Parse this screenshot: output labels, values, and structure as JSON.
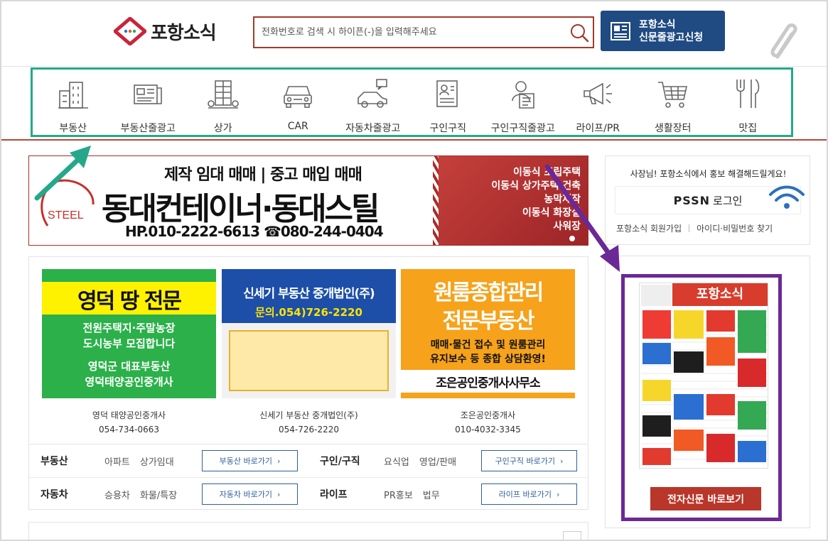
{
  "header": {
    "logo_text": "포항소식",
    "search_placeholder": "전화번호로 검색 시 하이픈(-)을 입력해주세요",
    "ad_button_line1": "포항소식",
    "ad_button_line2": "신문줄광고신청"
  },
  "nav": {
    "items": [
      {
        "label": "부동산",
        "icon": "building-icon"
      },
      {
        "label": "부동산줄광고",
        "icon": "newspaper-icon"
      },
      {
        "label": "상가",
        "icon": "store-icon"
      },
      {
        "label": "CAR",
        "icon": "car-icon"
      },
      {
        "label": "자동차줄광고",
        "icon": "car-message-icon"
      },
      {
        "label": "구인구직",
        "icon": "resume-icon"
      },
      {
        "label": "구인구직줄광고",
        "icon": "job-seeker-icon"
      },
      {
        "label": "라이프/PR",
        "icon": "megaphone-icon"
      },
      {
        "label": "생활장터",
        "icon": "cart-icon"
      },
      {
        "label": "맛집",
        "icon": "fork-knife-icon"
      }
    ]
  },
  "banner": {
    "logo_text": "STEEL",
    "top_line": "제작 임대 매매 | 중고 매입 매매",
    "main_line": "동대컨테이너·동대스틸",
    "phone_line": "HP.010-2222-6613 ☎080-244-0404",
    "right_lines": [
      "이동식 조립주택",
      "이동식 상가주택 건축",
      "농막제작",
      "이동식 화장실",
      "사워장"
    ]
  },
  "cards": [
    {
      "name": "영덕 태양공인중개사",
      "phone": "054-734-0663",
      "img_title": "영덕 땅 전문",
      "img_line1": "전원주택지·주말농장",
      "img_line2": "도시농부 모집합니다",
      "img_line3": "영덕군 대표부동산",
      "img_line4": "영덕태양공인중개사"
    },
    {
      "name": "신세기 부동산 중개법인(주)",
      "phone": "054-726-2220",
      "img_title": "신세기 부동산 중개법인(주)",
      "img_phone": "문의.054)726-2220"
    },
    {
      "name": "조은공인중개사",
      "phone": "010-4032-3345",
      "img_title1": "원룸종합관리",
      "img_title2": "전문부동산",
      "img_line1": "매매·물건 접수 및 원룸관리",
      "img_line2": "유지보수 등 종합 상담환영!",
      "img_line3": "조은공인중개사사무소"
    }
  ],
  "quick": [
    {
      "title": "부동산",
      "links": [
        "아파트",
        "상가임대"
      ],
      "button": "부동산 바로가기"
    },
    {
      "title": "구인/구직",
      "links": [
        "요식업",
        "영업/판매"
      ],
      "button": "구인구직 바로가기"
    },
    {
      "title": "자동차",
      "links": [
        "승용차",
        "화물/특장"
      ],
      "button": "자동차 바로가기"
    },
    {
      "title": "라이프",
      "links": [
        "PR홍보",
        "법무"
      ],
      "button": "라이프 바로가기"
    }
  ],
  "login": {
    "message": "사장님! 포항소식에서 홍보 해결해드릴게요!",
    "pssn": "PSSN",
    "login_label": "로그인",
    "signup": "포항소식 회원가입",
    "find": "아이디·비밀번호 찾기"
  },
  "newspaper": {
    "title": "포항소식",
    "button": "전자신문 바로보기"
  },
  "colors": {
    "brand_red": "#b8362a",
    "brand_blue": "#1f4a82",
    "nav_highlight": "#25a88a",
    "news_highlight": "#6b2897"
  }
}
